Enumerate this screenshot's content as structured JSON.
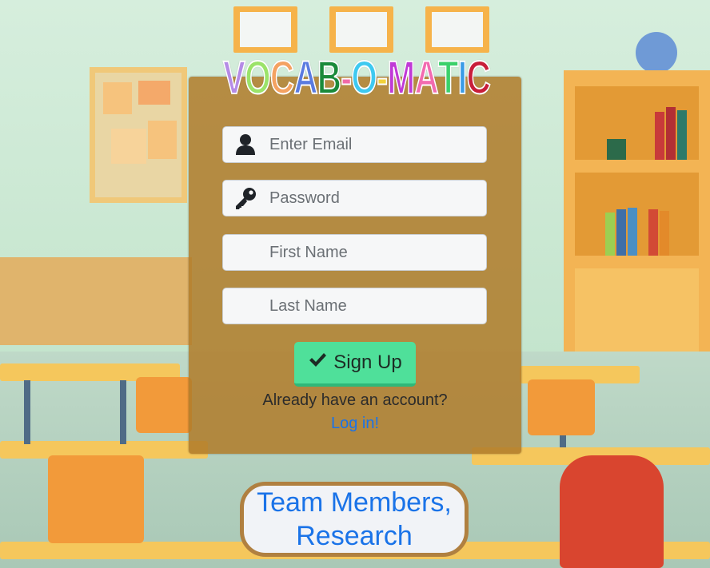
{
  "logo": {
    "letters": [
      "V",
      "O",
      "C",
      "A",
      "B",
      "-",
      "O",
      "-",
      "M",
      "A",
      "T",
      "I",
      "C"
    ],
    "colors": [
      "#b58be6",
      "#9be36a",
      "#f4a261",
      "#5a7be0",
      "#1a8a3a",
      "#f16aa8",
      "#3ec9f0",
      "#f2d23a",
      "#c03ad6",
      "#f26bb0",
      "#3ad06a",
      "#3a9be6",
      "#c81e3a"
    ]
  },
  "form": {
    "email": {
      "placeholder": "Enter Email",
      "icon": "user-icon"
    },
    "password": {
      "placeholder": "Password",
      "icon": "key-icon"
    },
    "first_name": {
      "placeholder": "First Name"
    },
    "last_name": {
      "placeholder": "Last Name"
    },
    "signup_label": "Sign Up",
    "signup_icon": "check-icon",
    "already_text": "Already have an account?",
    "login_link": "Log in!"
  },
  "team": {
    "line1": "Team Members,",
    "line2": "Research"
  },
  "colors": {
    "panel": "#b07c2a",
    "signup_button": "#4fe09a",
    "link": "#1a73e8",
    "team_border": "#b08040"
  }
}
